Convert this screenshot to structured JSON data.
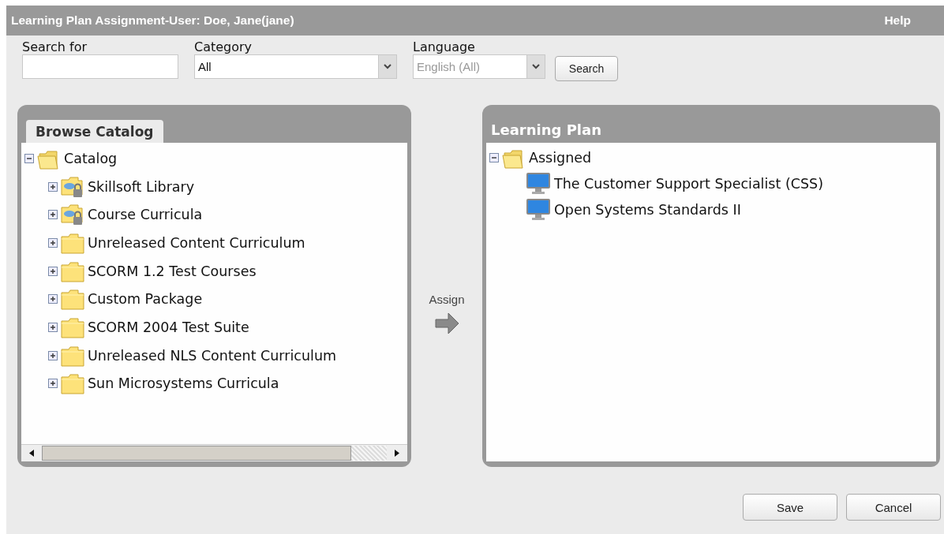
{
  "window": {
    "title": "Learning Plan Assignment-User: Doe, Jane(jane)",
    "help": "Help"
  },
  "filters": {
    "search": {
      "label": "Search for"
    },
    "category": {
      "label": "Category",
      "value": "All",
      "disabled": false
    },
    "language": {
      "label": "Language",
      "value": "English (All)",
      "disabled": true
    },
    "search_button": "Search"
  },
  "catalog": {
    "tab": {
      "label": "Browse Catalog",
      "selected": true
    },
    "tree": [
      {
        "label": "Catalog",
        "kind": "folder",
        "expanded": true,
        "children": [
          {
            "label": "Skillsoft Library",
            "kind": "locked-folder",
            "expanded": false
          },
          {
            "label": "Course Curricula",
            "kind": "locked-folder",
            "expanded": false
          },
          {
            "label": "Unreleased Content Curriculum",
            "kind": "folder",
            "expanded": false
          },
          {
            "label": "SCORM 1.2 Test Courses",
            "kind": "folder",
            "expanded": false
          },
          {
            "label": "Custom Package",
            "kind": "folder",
            "expanded": false
          },
          {
            "label": "SCORM 2004 Test Suite",
            "kind": "folder",
            "expanded": false
          },
          {
            "label": "Unreleased NLS Content Curriculum",
            "kind": "folder",
            "expanded": false
          },
          {
            "label": "Sun Microsystems Curricula",
            "kind": "folder",
            "expanded": false
          }
        ]
      }
    ]
  },
  "assign": {
    "label": "Assign"
  },
  "learning_plan": {
    "title": "Learning Plan",
    "tree": [
      {
        "label": "Assigned",
        "kind": "folder",
        "expanded": true,
        "children": [
          {
            "label": "The Customer Support Specialist (CSS)",
            "kind": "course"
          },
          {
            "label": "Open Systems Standards II",
            "kind": "course"
          }
        ]
      }
    ]
  },
  "buttons": [
    "Save",
    "Cancel"
  ]
}
